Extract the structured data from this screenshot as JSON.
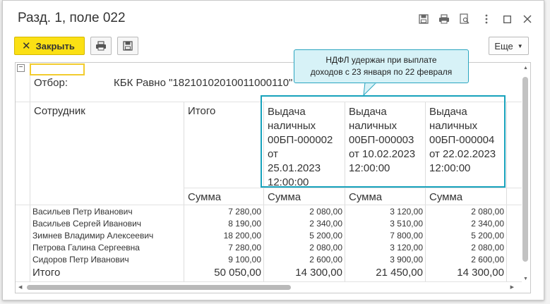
{
  "window": {
    "title": "Разд. 1, поле 022",
    "icons": [
      "save-icon",
      "print-icon",
      "preview-icon",
      "more-vertical-icon",
      "maximize-icon",
      "close-icon"
    ]
  },
  "toolbar": {
    "close_label": "Закрыть",
    "more_label": "Еще"
  },
  "report": {
    "filter_label": "Отбор:",
    "filter_value": "КБК Равно \"18210102010011000110\"",
    "employee_header": "Сотрудник",
    "total_header": "Итого",
    "columns": [
      [
        "Выдача",
        "наличных",
        "00БП-000002",
        "от",
        "25.01.2023",
        "12:00:00"
      ],
      [
        "Выдача",
        "наличных",
        "00БП-000003",
        "от 10.02.2023",
        "12:00:00"
      ],
      [
        "Выдача",
        "наличных",
        "00БП-000004",
        "от 22.02.2023",
        "12:00:00"
      ]
    ],
    "sum_label": "Сумма",
    "rows": [
      {
        "name": "Васильев Петр Иванович",
        "total": "7 280,00",
        "c1": "2 080,00",
        "c2": "3 120,00",
        "c3": "2 080,00"
      },
      {
        "name": "Васильев Сергей Иванович",
        "total": "8 190,00",
        "c1": "2 340,00",
        "c2": "3 510,00",
        "c3": "2 340,00"
      },
      {
        "name": "Зимнев Владимир Алексеевич",
        "total": "18 200,00",
        "c1": "5 200,00",
        "c2": "7 800,00",
        "c3": "5 200,00"
      },
      {
        "name": "Петрова Галина Сергеевна",
        "total": "7 280,00",
        "c1": "2 080,00",
        "c2": "3 120,00",
        "c3": "2 080,00"
      },
      {
        "name": "Сидоров Петр Иванович",
        "total": "9 100,00",
        "c1": "2 600,00",
        "c2": "3 900,00",
        "c3": "2 600,00"
      }
    ],
    "totals": {
      "label": "Итого",
      "total": "50 050,00",
      "c1": "14 300,00",
      "c2": "21 450,00",
      "c3": "14 300,00"
    }
  },
  "callout": {
    "line1": "НДФЛ удержан при выплате",
    "line2": "доходов с 23 января по 22 февраля"
  },
  "colors": {
    "accent_yellow": "#fbe014",
    "highlight_teal": "#17a2bc",
    "callout_bg": "#d7f2f7"
  }
}
